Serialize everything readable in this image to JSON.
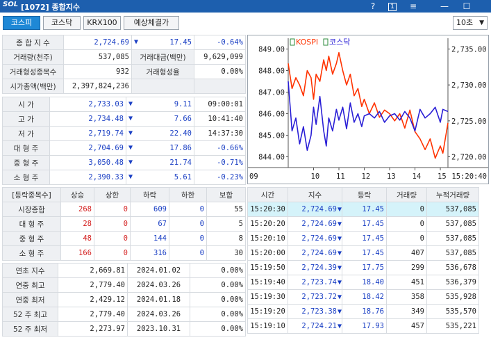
{
  "titlebar": {
    "logo": "SOL",
    "title": "[1072] 종합지수",
    "help": "?",
    "badge": "1",
    "menu": "≡",
    "minimize": "—",
    "maximize": "☐"
  },
  "tabs": [
    {
      "label": "코스피",
      "active": true
    },
    {
      "label": "코스닥",
      "active": false
    },
    {
      "label": "KRX100",
      "active": false
    },
    {
      "label": "예상체결가",
      "active": false
    }
  ],
  "interval": {
    "value": "10초",
    "arrow": "▼"
  },
  "summary": {
    "index_label": "종 합 지 수",
    "index_value": "2,724.69",
    "index_arrow": "▼",
    "index_change": "17.45",
    "index_pct": "-0.64%",
    "volume_label": "거래량(천주)",
    "volume_value": "537,085",
    "amount_label": "거래대금(백만)",
    "amount_value": "9,629,099",
    "formed_count_label": "거래형성종목수",
    "formed_count_value": "932",
    "formed_rate_label": "거래형성율",
    "formed_rate_value": "0.00%",
    "mcap_label": "시가총액(백만)",
    "mcap_value": "2,397,824,236"
  },
  "prices": [
    {
      "label": "시      가",
      "value": "2,733.03",
      "arrow": "▼",
      "change": "9.11",
      "extra": "09:00:01"
    },
    {
      "label": "고      가",
      "value": "2,734.48",
      "arrow": "▼",
      "change": "7.66",
      "extra": "10:41:40"
    },
    {
      "label": "저      가",
      "value": "2,719.74",
      "arrow": "▼",
      "change": "22.40",
      "extra": "14:37:30"
    },
    {
      "label": "대 형 주",
      "value": "2,704.69",
      "arrow": "▼",
      "change": "17.86",
      "extra": "-0.66%"
    },
    {
      "label": "중 형 주",
      "value": "3,050.48",
      "arrow": "▼",
      "change": "21.74",
      "extra": "-0.71%"
    },
    {
      "label": "소 형 주",
      "value": "2,390.33",
      "arrow": "▼",
      "change": "5.61",
      "extra": "-0.23%"
    }
  ],
  "breadth": {
    "headers": [
      "[등락종목수]",
      "상승",
      "상한",
      "하락",
      "하한",
      "보합"
    ],
    "rows": [
      {
        "label": "시장종합",
        "up": "268",
        "upper": "0",
        "down": "609",
        "lower": "0",
        "flat": "55"
      },
      {
        "label": "대 형 주",
        "up": "28",
        "upper": "0",
        "down": "67",
        "lower": "0",
        "flat": "5"
      },
      {
        "label": "중 형 주",
        "up": "48",
        "upper": "0",
        "down": "144",
        "lower": "0",
        "flat": "8"
      },
      {
        "label": "소 형 주",
        "up": "166",
        "upper": "0",
        "down": "316",
        "lower": "0",
        "flat": "30"
      }
    ]
  },
  "extremes": [
    {
      "label": "연초  지수",
      "value": "2,669.81",
      "date": "2024.01.02",
      "pct": "0.00%"
    },
    {
      "label": "연중  최고",
      "value": "2,779.40",
      "date": "2024.03.26",
      "pct": "0.00%"
    },
    {
      "label": "연중  최저",
      "value": "2,429.12",
      "date": "2024.01.18",
      "pct": "0.00%"
    },
    {
      "label": "52 주 최고",
      "value": "2,779.40",
      "date": "2024.03.26",
      "pct": "0.00%"
    },
    {
      "label": "52 주 최저",
      "value": "2,273.97",
      "date": "2023.10.31",
      "pct": "0.00%"
    }
  ],
  "ticks": {
    "headers": [
      "시간",
      "지수",
      "등락",
      "거래량",
      "누적거래량"
    ],
    "rows": [
      {
        "time": "15:20:30",
        "index": "2,724.69",
        "arrow": "▼",
        "change": "17.45",
        "vol": "0",
        "cum": "537,085",
        "selected": true
      },
      {
        "time": "15:20:20",
        "index": "2,724.69",
        "arrow": "▼",
        "change": "17.45",
        "vol": "0",
        "cum": "537,085",
        "selected": false
      },
      {
        "time": "15:20:10",
        "index": "2,724.69",
        "arrow": "▼",
        "change": "17.45",
        "vol": "0",
        "cum": "537,085",
        "selected": false
      },
      {
        "time": "15:20:00",
        "index": "2,724.69",
        "arrow": "▼",
        "change": "17.45",
        "vol": "407",
        "cum": "537,085",
        "selected": false
      },
      {
        "time": "15:19:50",
        "index": "2,724.39",
        "arrow": "▼",
        "change": "17.75",
        "vol": "299",
        "cum": "536,678",
        "selected": false
      },
      {
        "time": "15:19:40",
        "index": "2,723.74",
        "arrow": "▼",
        "change": "18.40",
        "vol": "451",
        "cum": "536,379",
        "selected": false
      },
      {
        "time": "15:19:30",
        "index": "2,723.72",
        "arrow": "▼",
        "change": "18.42",
        "vol": "358",
        "cum": "535,928",
        "selected": false
      },
      {
        "time": "15:19:20",
        "index": "2,723.38",
        "arrow": "▼",
        "change": "18.76",
        "vol": "349",
        "cum": "535,570",
        "selected": false
      },
      {
        "time": "15:19:10",
        "index": "2,724.21",
        "arrow": "▼",
        "change": "17.93",
        "vol": "457",
        "cum": "535,221",
        "selected": false
      }
    ]
  },
  "chart_data": {
    "type": "line",
    "legend": [
      "KOSPI",
      "코스닥"
    ],
    "legend_colors": [
      "#ff3300",
      "#2a1fd6"
    ],
    "x_ticks": [
      "09",
      "10",
      "11",
      "12",
      "13",
      "14",
      "15",
      "15:20:40"
    ],
    "left_axis": {
      "ticks": [
        "849.00",
        "848.00",
        "847.00",
        "846.00",
        "845.00",
        "844.00"
      ],
      "range": [
        843.5,
        849.5
      ]
    },
    "right_axis": {
      "ticks": [
        "2,735.00",
        "2,730.00",
        "2,725.00",
        "2,720.00"
      ],
      "range": [
        2718.5,
        2736.5
      ]
    },
    "series": [
      {
        "name": "KOSPI",
        "axis": "right",
        "color": "#ff3300",
        "x": [
          0,
          0.15,
          0.3,
          0.45,
          0.6,
          0.75,
          0.9,
          1.0,
          1.1,
          1.25,
          1.4,
          1.5,
          1.6,
          1.75,
          1.9,
          2.0,
          2.15,
          2.3,
          2.45,
          2.6,
          2.75,
          2.9,
          3.0,
          3.2,
          3.4,
          3.6,
          3.8,
          4.0,
          4.2,
          4.4,
          4.6,
          4.8,
          5.0,
          5.2,
          5.4,
          5.6,
          5.8,
          6.0,
          6.1,
          6.3
        ],
        "y": [
          2733.0,
          2729.5,
          2731.0,
          2730.0,
          2728.5,
          2732.0,
          2731.0,
          2728.0,
          2731.5,
          2730.5,
          2733.5,
          2732.0,
          2734.0,
          2731.5,
          2733.0,
          2734.5,
          2732.0,
          2730.0,
          2731.5,
          2728.5,
          2729.5,
          2727.0,
          2728.0,
          2726.0,
          2727.5,
          2725.5,
          2726.5,
          2726.0,
          2725.0,
          2726.0,
          2724.0,
          2726.5,
          2723.5,
          2722.5,
          2721.0,
          2722.5,
          2719.8,
          2721.5,
          2720.5,
          2724.7
        ]
      },
      {
        "name": "코스닥",
        "axis": "left",
        "color": "#2a1fd6",
        "x": [
          0,
          0.15,
          0.3,
          0.45,
          0.6,
          0.75,
          0.9,
          1.0,
          1.1,
          1.25,
          1.4,
          1.5,
          1.6,
          1.75,
          1.9,
          2.0,
          2.15,
          2.3,
          2.45,
          2.6,
          2.75,
          2.9,
          3.0,
          3.2,
          3.4,
          3.6,
          3.8,
          4.0,
          4.2,
          4.4,
          4.6,
          4.8,
          5.0,
          5.2,
          5.4,
          5.6,
          5.8,
          6.0,
          6.1,
          6.3
        ],
        "y": [
          847.5,
          845.2,
          845.8,
          844.6,
          845.4,
          844.3,
          845.0,
          846.3,
          845.5,
          846.8,
          845.2,
          844.5,
          845.8,
          845.2,
          846.2,
          845.7,
          846.3,
          845.3,
          846.5,
          845.6,
          846.0,
          845.4,
          845.9,
          846.0,
          845.8,
          846.1,
          845.6,
          845.9,
          846.0,
          845.7,
          846.1,
          845.8,
          845.2,
          846.2,
          845.8,
          846.0,
          846.3,
          845.6,
          846.2,
          846.1
        ]
      }
    ]
  }
}
